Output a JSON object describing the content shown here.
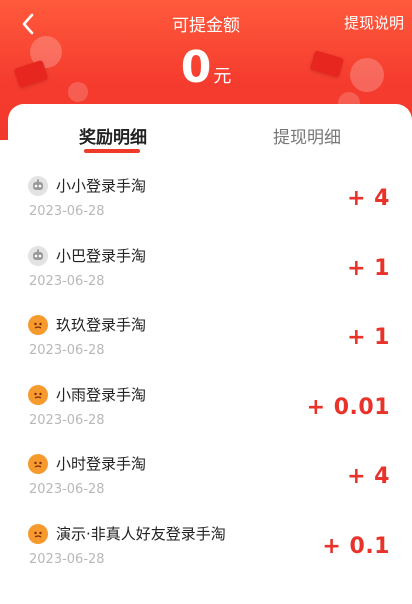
{
  "header": {
    "title": "可提金额",
    "explain_label": "提现说明",
    "amount_value": "0",
    "amount_unit": "元"
  },
  "tabs": [
    {
      "label": "奖励明细",
      "active": true
    },
    {
      "label": "提现明细",
      "active": false
    }
  ],
  "colors": {
    "accent": "#f23a2c",
    "amount_text": "#e8322a"
  },
  "records": [
    {
      "name": "小小登录手淘",
      "date": "2023-06-28",
      "amount": "+ 4",
      "avatar": "robot-icon"
    },
    {
      "name": "小巴登录手淘",
      "date": "2023-06-28",
      "amount": "+ 1",
      "avatar": "robot-icon"
    },
    {
      "name": "玖玖登录手淘",
      "date": "2023-06-28",
      "amount": "+ 1",
      "avatar": "emoji-face-icon"
    },
    {
      "name": "小雨登录手淘",
      "date": "2023-06-28",
      "amount": "+ 0.01",
      "avatar": "emoji-face-icon"
    },
    {
      "name": "小时登录手淘",
      "date": "2023-06-28",
      "amount": "+ 4",
      "avatar": "emoji-face-icon"
    },
    {
      "name": "演示·非真人好友登录手淘",
      "date": "2023-06-28",
      "amount": "+ 0.1",
      "avatar": "emoji-face-icon"
    }
  ]
}
